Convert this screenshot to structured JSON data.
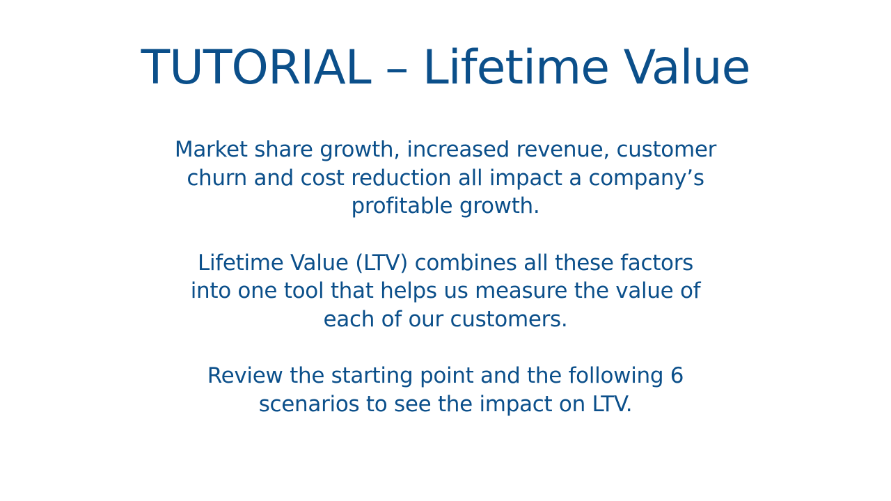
{
  "slide": {
    "title": "TUTORIAL – Lifetime Value",
    "paragraphs": [
      {
        "lines": [
          "Market share growth, increased revenue, customer",
          "churn and cost reduction all impact a company’s",
          "profitable growth."
        ]
      },
      {
        "lines": [
          "Lifetime Value (LTV) combines all these factors",
          "into one tool that helps us measure the value of",
          "each of our customers."
        ]
      },
      {
        "lines": [
          "Review the starting point and the following 6",
          "scenarios to see the impact on LTV."
        ]
      }
    ],
    "colors": {
      "text": "#0b4f8a",
      "background": "#ffffff"
    }
  }
}
